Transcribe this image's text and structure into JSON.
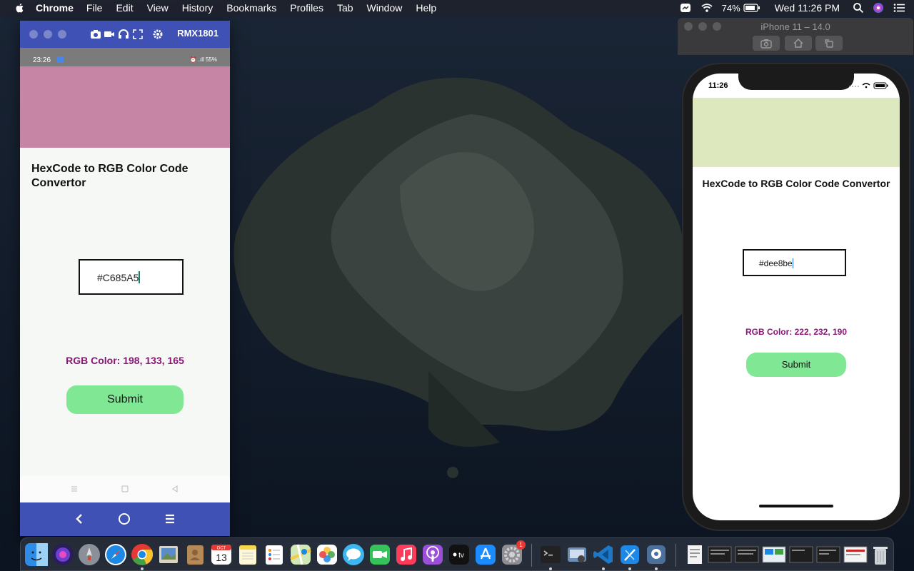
{
  "menubar": {
    "app_name": "Chrome",
    "menus": [
      "File",
      "Edit",
      "View",
      "History",
      "Bookmarks",
      "Profiles",
      "Tab",
      "Window",
      "Help"
    ],
    "battery_percent": "74%",
    "clock": "Wed 11:26 PM"
  },
  "android": {
    "device_name": "RMX1801",
    "status_time": "23:26",
    "status_right": "⏰ .ıll 55%",
    "swatch_color": "#C685A5",
    "title": "HexCode to RGB Color Code Convertor",
    "hex_value": "#C685A5",
    "rgb_text": "RGB Color: 198, 133, 165",
    "submit_label": "Submit"
  },
  "ios": {
    "window_title": "iPhone 11 – 14.0",
    "status_time": "11:26",
    "swatch_color": "#dee8be",
    "title": "HexCode to RGB Color Code Convertor",
    "hex_value": "#dee8be",
    "rgb_text": "RGB Color: 222, 232, 190",
    "submit_label": "Submit"
  },
  "dock": {
    "calendar_month": "OCT",
    "calendar_day": "13",
    "appstore_badge": "1",
    "tv_label": "tv",
    "apps": [
      {
        "name": "finder",
        "color": "#2f8be8"
      },
      {
        "name": "siri",
        "color": "#5e2ca5"
      },
      {
        "name": "launchpad",
        "color": "#8a8f98"
      },
      {
        "name": "safari",
        "color": "#1e88e5"
      },
      {
        "name": "chrome",
        "color": "#ffffff"
      },
      {
        "name": "preview",
        "color": "#5c8cc8"
      },
      {
        "name": "contacts",
        "color": "#b58a58"
      },
      {
        "name": "calendar",
        "color": "#ffffff"
      },
      {
        "name": "notes",
        "color": "#f7e27a"
      },
      {
        "name": "reminders",
        "color": "#ffffff"
      },
      {
        "name": "maps",
        "color": "#6bbf5a"
      },
      {
        "name": "photos",
        "color": "#ffffff"
      },
      {
        "name": "messages",
        "color": "#3cb6f0"
      },
      {
        "name": "facetime",
        "color": "#36c25a"
      },
      {
        "name": "music",
        "color": "#fb3c5a"
      },
      {
        "name": "podcasts",
        "color": "#9b4ed8"
      },
      {
        "name": "apple-tv",
        "color": "#111111"
      },
      {
        "name": "app-store",
        "color": "#1a8cff"
      },
      {
        "name": "system-preferences",
        "color": "#8e8e93"
      },
      {
        "name": "terminal",
        "color": "#222222"
      },
      {
        "name": "image-capture",
        "color": "#6d8fb6"
      },
      {
        "name": "vscode",
        "color": "#1e78c8"
      },
      {
        "name": "xcode",
        "color": "#1d88e8"
      },
      {
        "name": "simulator",
        "color": "#4d6f9c"
      }
    ]
  }
}
